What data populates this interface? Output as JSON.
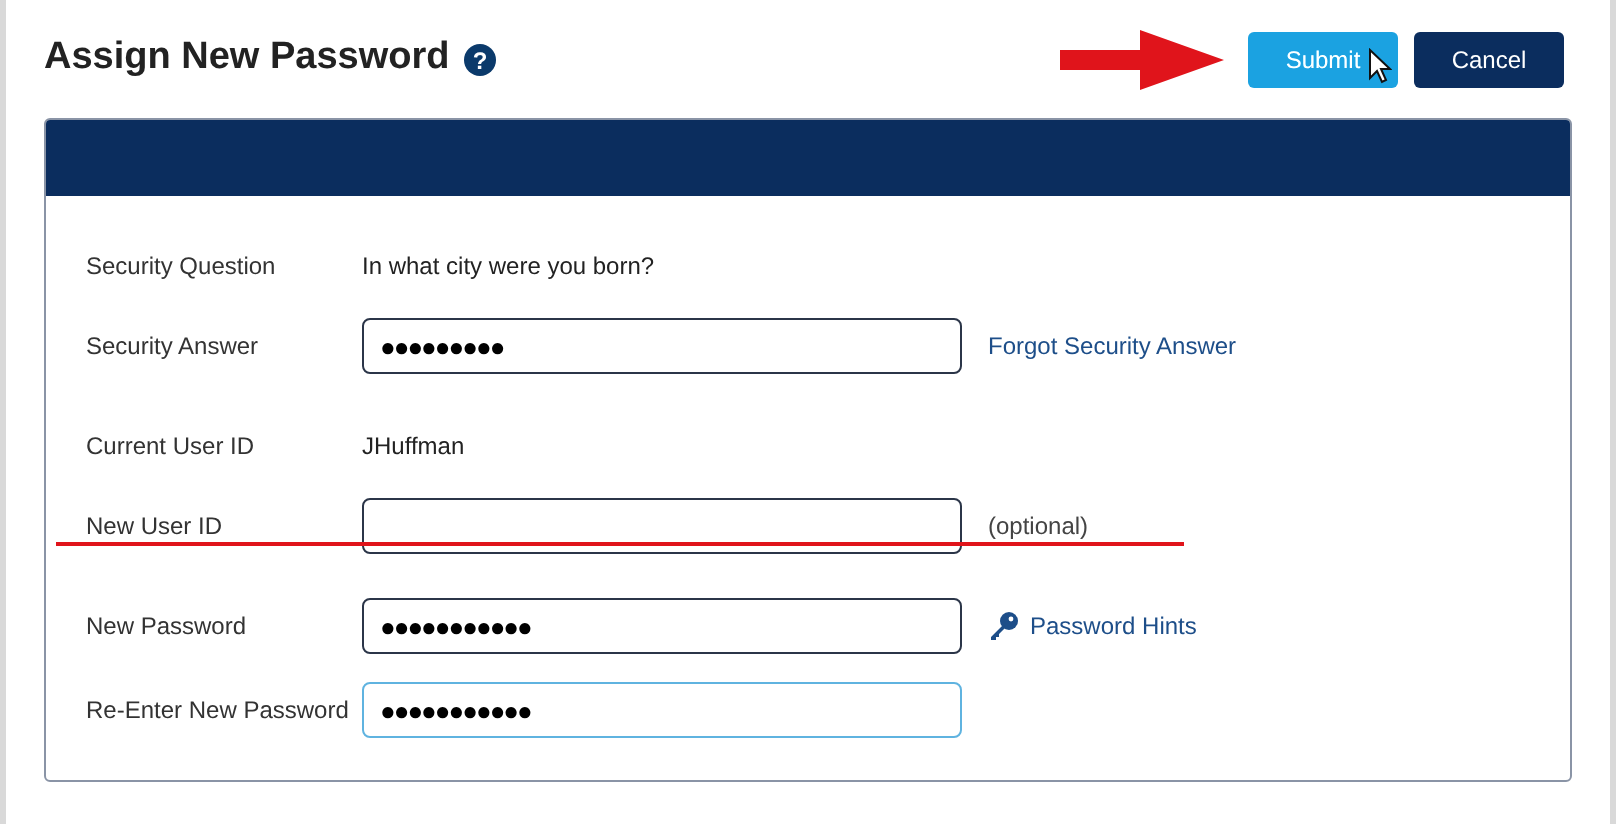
{
  "title": "Assign New Password",
  "help_glyph": "?",
  "buttons": [
    {
      "label": "Submit",
      "kind": "primary",
      "hovered": true
    },
    {
      "label": "Cancel",
      "kind": "secondary",
      "hovered": false
    }
  ],
  "form": [
    {
      "kind": "text",
      "label": "Security Question",
      "value": "In what city were you born?"
    },
    {
      "kind": "input",
      "label": "Security Answer",
      "value": "●●●●●●●●●",
      "focused": false,
      "aside": {
        "kind": "link",
        "text": "Forgot Security Answer"
      }
    },
    {
      "kind": "text",
      "label": "Current User ID",
      "value": "JHuffman"
    },
    {
      "kind": "input",
      "label": "New User ID",
      "focused": false,
      "struck": true,
      "aside": {
        "kind": "note",
        "text": "(optional)"
      }
    },
    {
      "kind": "input",
      "label": "New Password",
      "value": "●●●●●●●●●●●",
      "focused": false,
      "aside": {
        "kind": "key-link",
        "text": "Password Hints"
      }
    },
    {
      "kind": "input",
      "label": "Re-Enter New Password",
      "value": "●●●●●●●●●●●",
      "focused": true
    }
  ]
}
